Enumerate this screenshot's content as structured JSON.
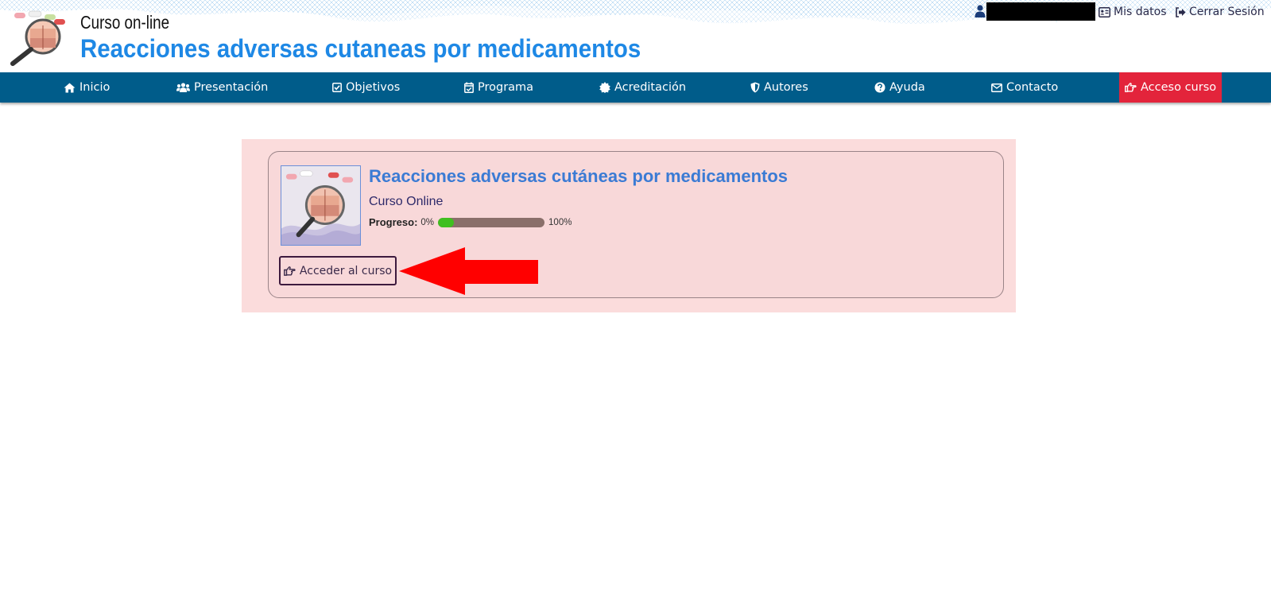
{
  "header": {
    "kicker": "Curso on-line",
    "title": "Reacciones adversas cutaneas por medicamentos",
    "mis_datos": "Mis datos",
    "cerrar_sesion": "Cerrar Sesión"
  },
  "nav": {
    "items": [
      {
        "label": "Inicio",
        "icon": "home-icon"
      },
      {
        "label": "Presentación",
        "icon": "users-icon"
      },
      {
        "label": "Objetivos",
        "icon": "check-square-icon"
      },
      {
        "label": "Programa",
        "icon": "calendar-check-icon"
      },
      {
        "label": "Acreditación",
        "icon": "certificate-icon"
      },
      {
        "label": "Autores",
        "icon": "shield-icon"
      },
      {
        "label": "Ayuda",
        "icon": "question-circle-icon"
      },
      {
        "label": "Contacto",
        "icon": "envelope-icon"
      },
      {
        "label": "Acceso curso",
        "icon": "hand-point-right-icon"
      }
    ]
  },
  "course": {
    "title": "Reacciones adversas cutáneas por medicamentos",
    "subtitle": "Curso Online",
    "progress_label": "Progreso:",
    "progress_min": "0%",
    "progress_max": "100%",
    "progress_value": 0.15,
    "access_button": "Acceder al curso"
  },
  "colors": {
    "brand_blue": "#1e88e5",
    "nav_bg": "#005c8a",
    "nav_access_bg": "#e3243b",
    "panel_bg": "#fbdcdc",
    "progress_fill": "#3fbf1f",
    "arrow": "#ff0000"
  }
}
